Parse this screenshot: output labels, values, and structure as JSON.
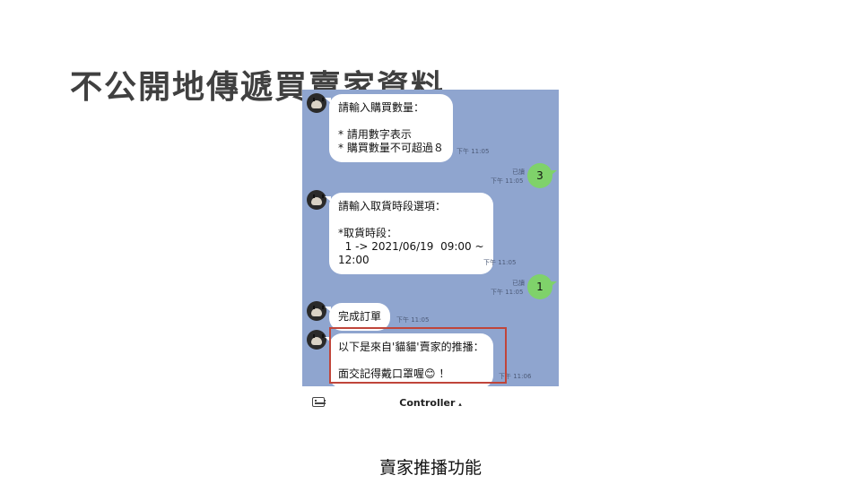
{
  "slide": {
    "title": "不公開地傳遞買賣家資料",
    "caption": "賣家推播功能"
  },
  "chat": {
    "messages": [
      {
        "side": "incoming",
        "text": "請輸入購買數量：\n\n* 請用數字表示\n* 購買數量不可超過８",
        "time": "下午 11:05"
      },
      {
        "side": "outgoing",
        "text": "3",
        "read": "已讀",
        "time": "下午 11:05"
      },
      {
        "side": "incoming",
        "text": "請輸入取貨時段選項：\n\n*取貨時段：\n  1 -> 2021/06/19  09:00 ~\n12:00",
        "time": "下午 11:05"
      },
      {
        "side": "outgoing",
        "text": "1",
        "read": "已讀",
        "time": "下午 11:05"
      },
      {
        "side": "incoming",
        "text": "完成訂單",
        "time": "下午 11:05"
      },
      {
        "side": "incoming",
        "text": "以下是來自'貓貓'賣家的推播：\n\n面交記得戴口罩喔😊 ！",
        "time": "下午 11:06"
      }
    ],
    "bottom_bar": {
      "keyboard_icon": "keyboard-icon",
      "controller_label": "Controller",
      "caret": "▴"
    }
  },
  "colors": {
    "chat_background": "#8fa5cf",
    "outgoing_bubble": "#7fd26a",
    "incoming_bubble": "#ffffff",
    "highlight_border": "#c0453a",
    "title_text": "#404040"
  }
}
